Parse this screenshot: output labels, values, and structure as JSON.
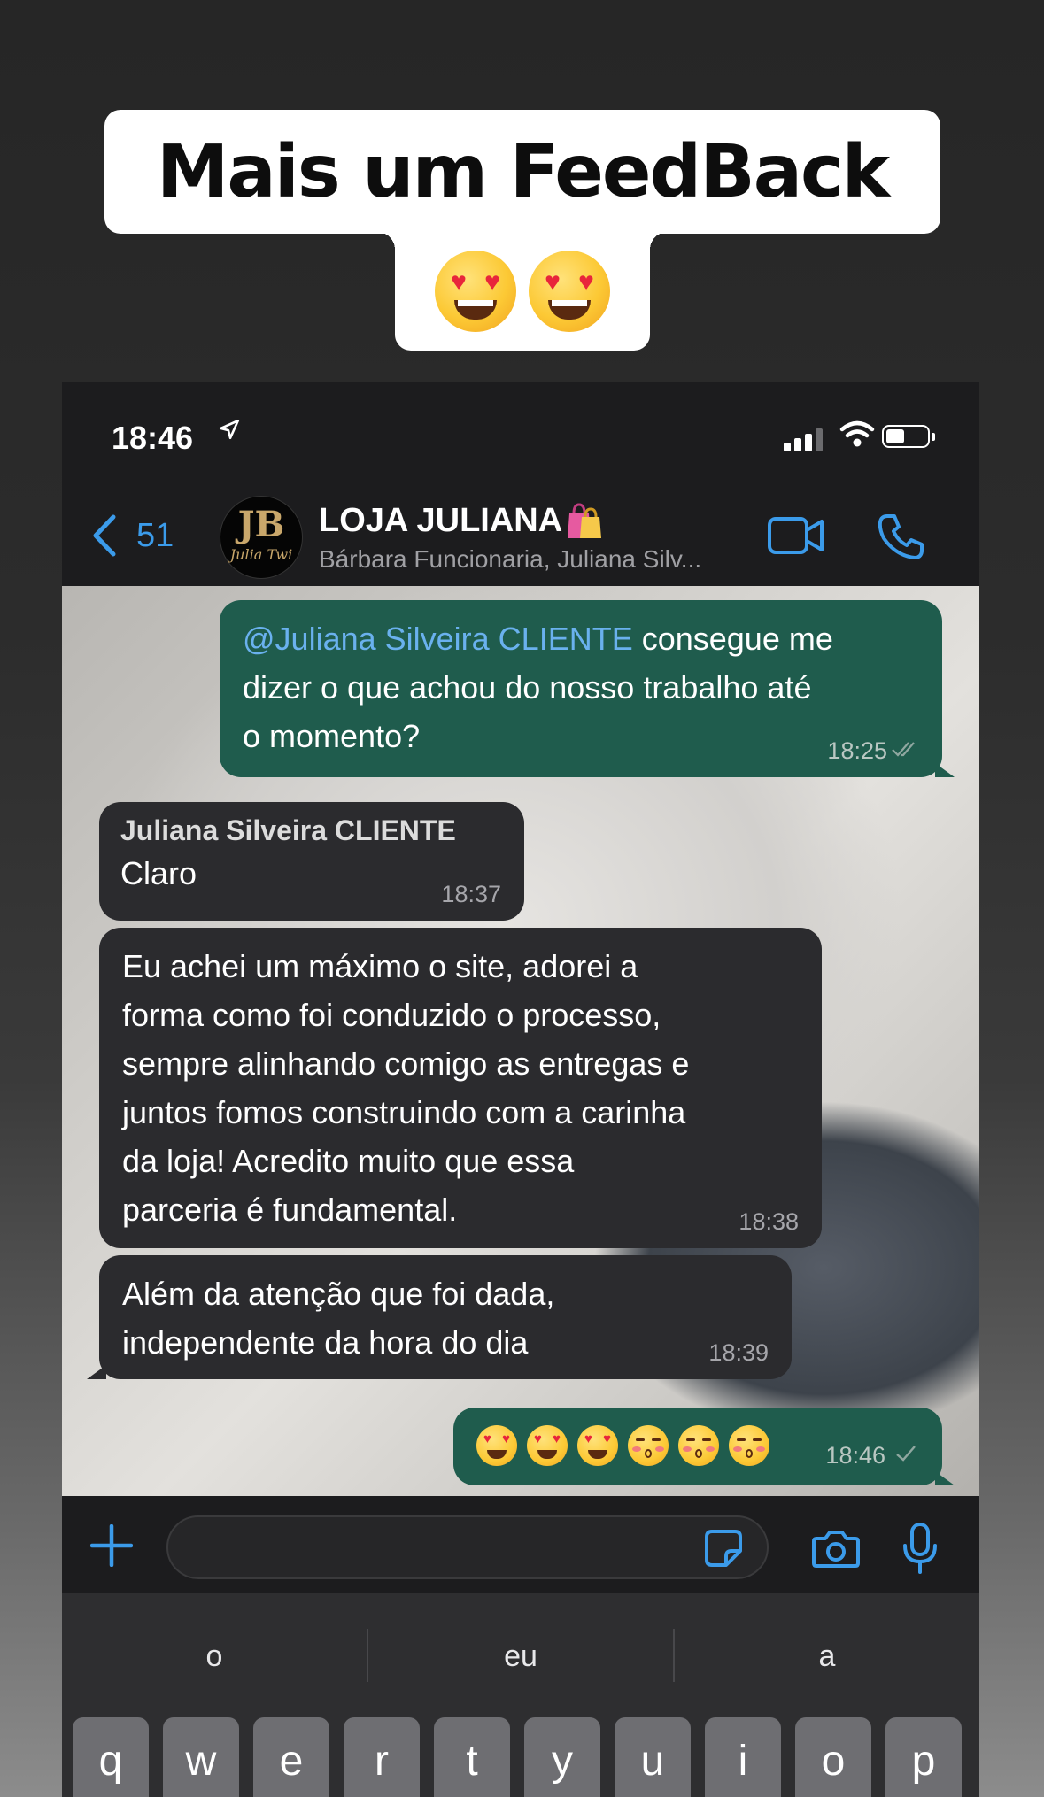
{
  "story": {
    "caption": "Mais um FeedBack",
    "caption_emojis": [
      "heart-eyes",
      "heart-eyes"
    ]
  },
  "status_bar": {
    "time": "18:46",
    "location_icon": "location-arrow-icon",
    "signal_icon": "signal-icon",
    "wifi_icon": "wifi-icon",
    "battery_icon": "battery-icon",
    "battery_level": 0.45
  },
  "header": {
    "back_count": "51",
    "group_name": "LOJA JULIANA",
    "group_emoji": "shopping-bags-icon",
    "participants": "Bárbara Funcionaria, Juliana Silv...",
    "avatar_monogram": "JB",
    "avatar_script": "Julia Twi",
    "video_icon": "video-call-icon",
    "phone_icon": "phone-call-icon"
  },
  "messages": [
    {
      "direction": "outgoing",
      "mention": "@Juliana Silveira CLIENTE",
      "lines": [
        " consegue me",
        "dizer o que achou do nosso trabalho até",
        "o momento?"
      ],
      "time": "18:25",
      "status": "read"
    },
    {
      "direction": "incoming",
      "sender": "Juliana Silveira CLIENTE",
      "lines": [
        "Claro"
      ],
      "time": "18:37"
    },
    {
      "direction": "incoming",
      "lines": [
        "Eu achei um máximo o site, adorei a",
        "forma como foi conduzido o processo,",
        "sempre alinhando comigo as entregas e",
        "juntos fomos construindo com a carinha",
        "da loja! Acredito muito que essa",
        "parceria é fundamental."
      ],
      "time": "18:38"
    },
    {
      "direction": "incoming",
      "lines": [
        "Além da atenção que foi dada,",
        "independente da hora do dia"
      ],
      "time": "18:39"
    },
    {
      "direction": "outgoing",
      "emojis": [
        "heart-eyes",
        "heart-eyes",
        "heart-eyes",
        "kissing-closed-eyes",
        "kissing-closed-eyes",
        "kissing-closed-eyes"
      ],
      "time": "18:46",
      "status": "sent"
    }
  ],
  "composer": {
    "plus_icon": "plus-icon",
    "sticker_icon": "sticker-icon",
    "camera_icon": "camera-icon",
    "mic_icon": "microphone-icon"
  },
  "keyboard": {
    "suggestions": [
      "o",
      "eu",
      "a"
    ],
    "row1": [
      "q",
      "w",
      "e",
      "r",
      "t",
      "y",
      "u",
      "i",
      "o",
      "p"
    ]
  },
  "colors": {
    "outgoing_bubble": "#1f5c4d",
    "incoming_bubble": "#2b2b2e",
    "accent": "#3b9bea",
    "mention": "#6ab1ee"
  }
}
